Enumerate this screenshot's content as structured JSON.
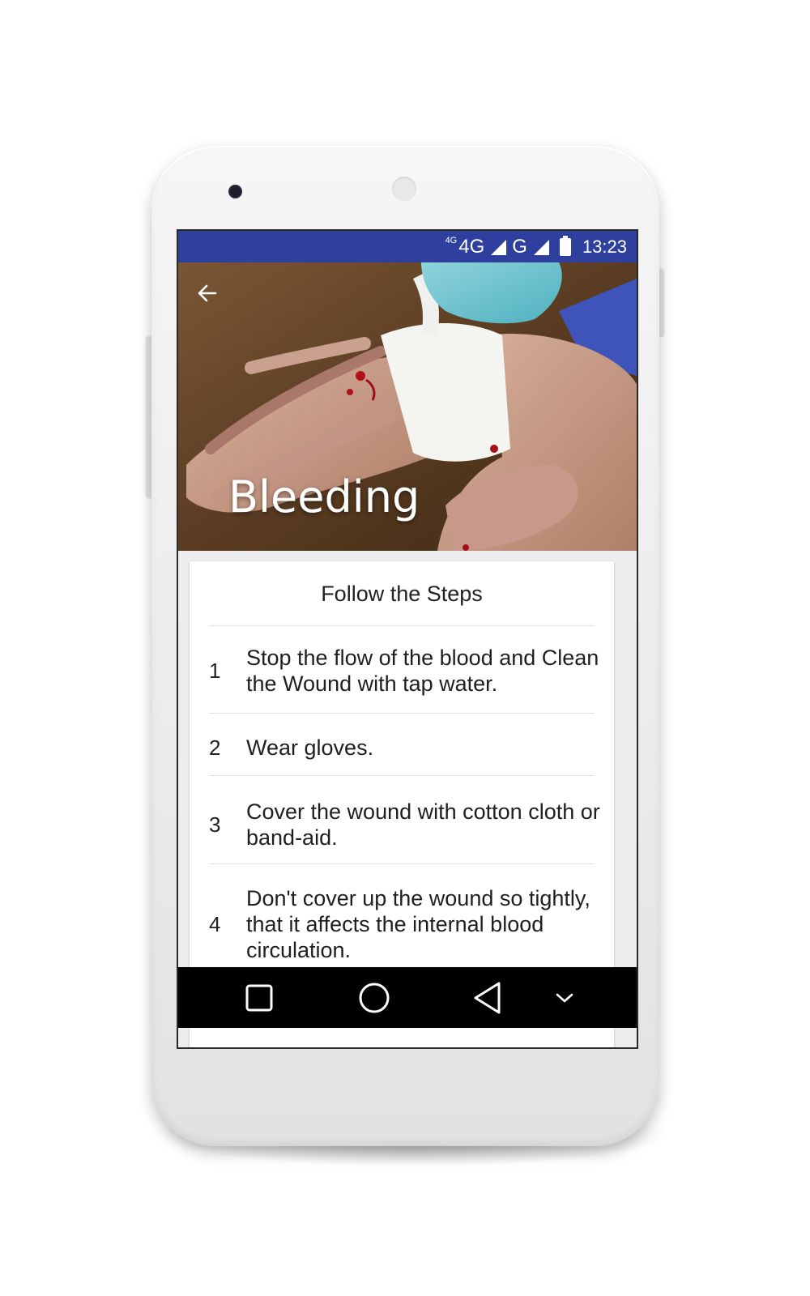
{
  "status_bar": {
    "network_small": "4G",
    "network_primary": "4G",
    "network_secondary": "G",
    "time": "13:23",
    "background_color": "#2f3f9d"
  },
  "header": {
    "back_icon": "arrow-left-icon",
    "title": "Bleeding"
  },
  "steps_card": {
    "title": "Follow the Steps",
    "steps": [
      {
        "number": "1",
        "text": "Stop the flow of the blood and Clean the Wound with tap water."
      },
      {
        "number": "2",
        "text": "Wear gloves."
      },
      {
        "number": "3",
        "text": "Cover the wound with cotton cloth or band-aid."
      },
      {
        "number": "4",
        "text": "Don't cover up the wound so tightly, that it affects the internal blood circulation."
      }
    ]
  },
  "nav_bar": {
    "buttons": [
      "recent-apps-icon",
      "home-icon",
      "back-triangle-icon",
      "chevron-down-icon"
    ]
  }
}
